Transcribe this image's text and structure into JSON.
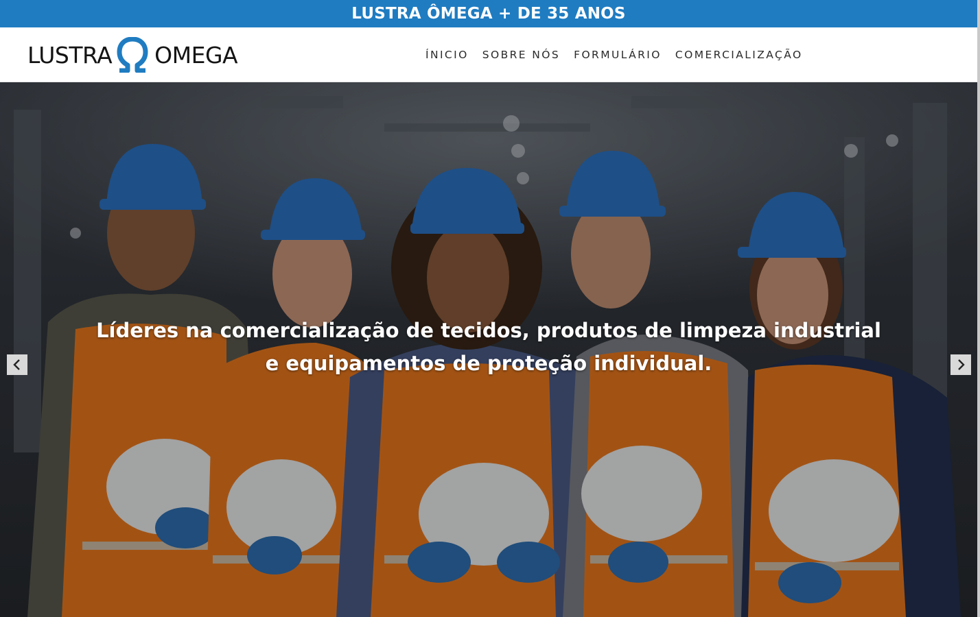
{
  "banner": {
    "text": "LUSTRA ÔMEGA + DE 35 ANOS"
  },
  "brand": {
    "logo_left": "LUSTRA",
    "logo_right": "OMEGA",
    "omega_color": "#1f7cc1"
  },
  "nav": {
    "items": [
      {
        "label": "ÍNICIO"
      },
      {
        "label": "SOBRE NÓS"
      },
      {
        "label": "FORMULÁRIO"
      },
      {
        "label": "COMERCIALIZAÇÃO"
      }
    ]
  },
  "hero": {
    "caption": "Líderes na comercialização de tecidos, produtos de limpeza industrial e equipamentos de proteção individual.",
    "prev_icon": "chevron-left-icon",
    "next_icon": "chevron-right-icon"
  },
  "colors": {
    "banner": "#1f7cc1",
    "hardhat_blue": "#2b72c2",
    "vest_orange": "#e8781e"
  }
}
